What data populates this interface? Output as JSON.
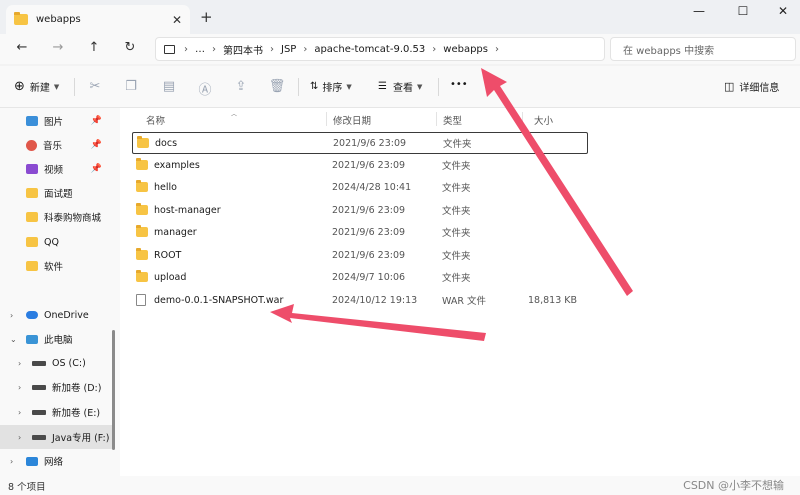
{
  "tab": {
    "title": "webapps",
    "close": "✕",
    "new": "+"
  },
  "window": {
    "minimize": "—",
    "maximize": "☐",
    "close": "✕"
  },
  "nav": {
    "back": "←",
    "forward": "→",
    "up": "↑",
    "refresh": "↻",
    "more": "…"
  },
  "breadcrumb": [
    "第四本书",
    "JSP",
    "apache-tomcat-9.0.53",
    "webapps"
  ],
  "search": {
    "placeholder": "在 webapps 中搜索"
  },
  "toolbar": {
    "new_label": "新建",
    "sort_label": "排序",
    "view_label": "查看",
    "more_label": "•••",
    "details_label": "详细信息"
  },
  "sidebar": {
    "items": [
      {
        "label": "图片",
        "icon": "pictures-icon",
        "pinned": true
      },
      {
        "label": "音乐",
        "icon": "music-icon",
        "pinned": true
      },
      {
        "label": "视频",
        "icon": "video-icon",
        "pinned": true
      },
      {
        "label": "面试题",
        "icon": "folder-icon",
        "pinned": false
      },
      {
        "label": "科泰购物商城",
        "icon": "folder-icon",
        "pinned": false
      },
      {
        "label": "QQ",
        "icon": "folder-icon",
        "pinned": false
      },
      {
        "label": "软件",
        "icon": "folder-icon",
        "pinned": false
      },
      {
        "label": "OneDrive",
        "icon": "cloud-icon",
        "pinned": false
      },
      {
        "label": "此电脑",
        "icon": "computer-icon",
        "pinned": false
      },
      {
        "label": "OS (C:)",
        "icon": "drive-icon",
        "pinned": false
      },
      {
        "label": "新加卷 (D:)",
        "icon": "drive-icon",
        "pinned": false
      },
      {
        "label": "新加卷 (E:)",
        "icon": "drive-icon",
        "pinned": false
      },
      {
        "label": "Java专用 (F:)",
        "icon": "drive-icon",
        "pinned": false
      },
      {
        "label": "网络",
        "icon": "network-icon",
        "pinned": false
      }
    ]
  },
  "columns": {
    "name": "名称",
    "modified": "修改日期",
    "type": "类型",
    "size": "大小"
  },
  "files": [
    {
      "name": "docs",
      "date": "2021/9/6 23:09",
      "type": "文件夹",
      "size": ""
    },
    {
      "name": "examples",
      "date": "2021/9/6 23:09",
      "type": "文件夹",
      "size": ""
    },
    {
      "name": "hello",
      "date": "2024/4/28 10:41",
      "type": "文件夹",
      "size": ""
    },
    {
      "name": "host-manager",
      "date": "2021/9/6 23:09",
      "type": "文件夹",
      "size": ""
    },
    {
      "name": "manager",
      "date": "2021/9/6 23:09",
      "type": "文件夹",
      "size": ""
    },
    {
      "name": "ROOT",
      "date": "2021/9/6 23:09",
      "type": "文件夹",
      "size": ""
    },
    {
      "name": "upload",
      "date": "2024/9/7 10:06",
      "type": "文件夹",
      "size": ""
    },
    {
      "name": "demo-0.0.1-SNAPSHOT.war",
      "date": "2024/10/12 19:13",
      "type": "WAR 文件",
      "size": "18,813 KB"
    }
  ],
  "status": {
    "count": "8 个项目"
  },
  "watermark": "CSDN @小李不想输",
  "colors": {
    "folder": "#f7c444",
    "arrow": "#ee4d6a",
    "accent": "#2b7de1"
  }
}
